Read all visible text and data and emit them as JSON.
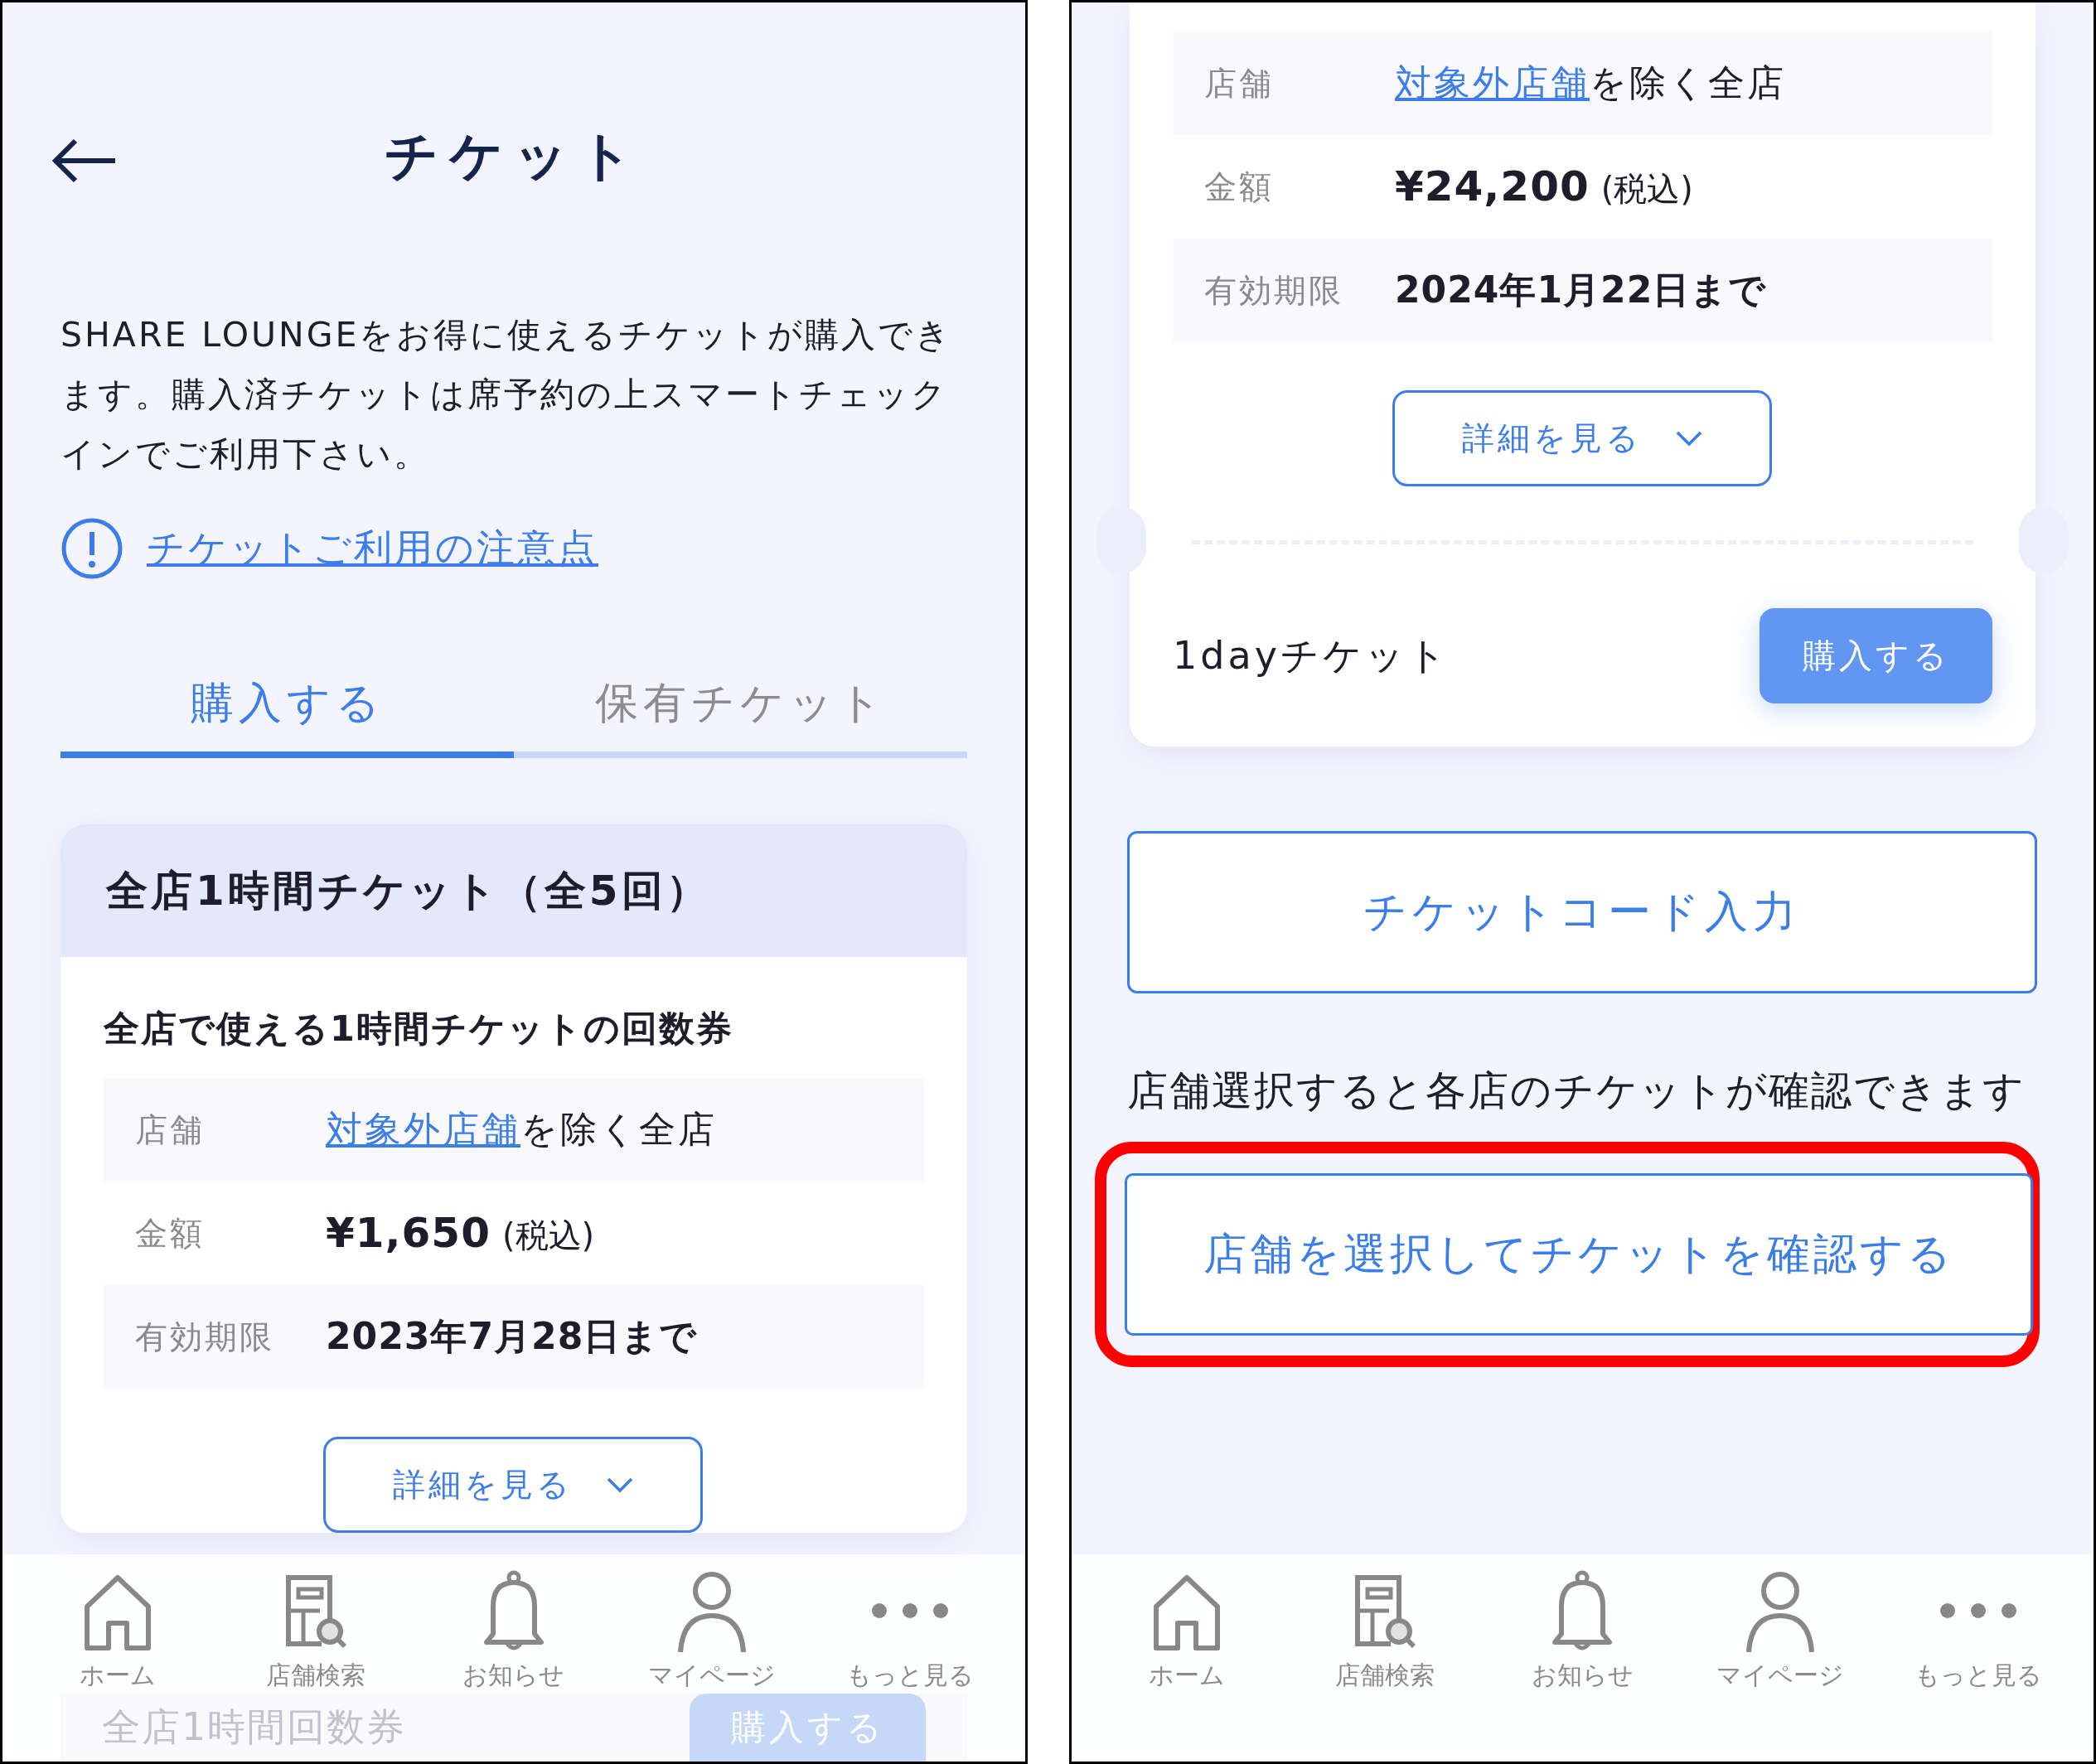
{
  "panels": [
    {
      "kind": "intro",
      "header": {
        "title": "チケット"
      },
      "description": "SHARE LOUNGEをお得に使えるチケットが購入できます。購入済チケットは席予約の上スマートチェックインでご利用下さい。",
      "notice_link": "チケットご利用の注意点",
      "tabs": [
        {
          "label": "購入する",
          "selected": true
        },
        {
          "label": "保有チケット",
          "selected": false
        }
      ],
      "ticket": {
        "title": "全店1時間チケット（全5回）",
        "subtitle": "全店で使える1時間チケットの回数券",
        "rows": [
          {
            "kind": "store",
            "label": "店舗",
            "link": "対象外店舗",
            "text": "を除く全店"
          },
          {
            "kind": "price",
            "label": "金額",
            "amount": "¥1,650",
            "note": "(税込)"
          },
          {
            "kind": "expiry",
            "label": "有効期限",
            "value": "2023年7月28日まで"
          }
        ],
        "details_button": "詳細を見る"
      },
      "faded_card": {
        "title": "全店1時間回数券",
        "button": "購入する"
      },
      "nav": [
        {
          "label": "ホーム"
        },
        {
          "label": "店舗検索"
        },
        {
          "label": "お知らせ"
        },
        {
          "label": "マイページ"
        },
        {
          "label": "もっと見る"
        }
      ]
    },
    {
      "kind": "continued",
      "ticket": {
        "rows": [
          {
            "kind": "store",
            "label": "店舗",
            "link": "対象外店舗",
            "text": "を除く全店"
          },
          {
            "kind": "price",
            "label": "金額",
            "amount": "¥24,200",
            "note": "(税込)"
          },
          {
            "kind": "expiry",
            "label": "有効期限",
            "value": "2024年1月22日まで"
          }
        ],
        "details_button": "詳細を見る",
        "name": "1dayチケット",
        "buy_button": "購入する"
      },
      "code_button": "チケットコード入力",
      "store_note": "店舗選択すると各店のチケットが確認できます",
      "store_button": {
        "label": "店舗を選択してチケットを確認する",
        "highlighted": true
      },
      "nav": [
        {
          "label": "ホーム"
        },
        {
          "label": "店舗検索"
        },
        {
          "label": "お知らせ"
        },
        {
          "label": "マイページ"
        },
        {
          "label": "もっと見る"
        }
      ]
    }
  ]
}
